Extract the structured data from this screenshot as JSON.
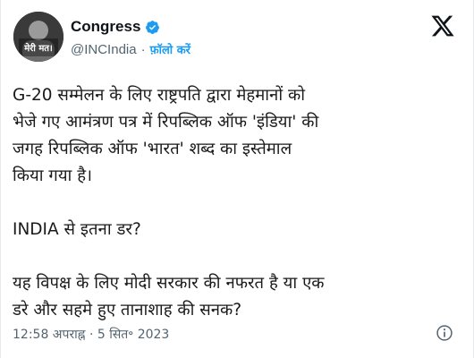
{
  "account": {
    "display_name": "Congress",
    "handle": "@INCIndia",
    "separator": "·",
    "follow_label": "फ़ॉलो करें",
    "avatar_text": "मेरी मत।"
  },
  "tweet": {
    "paragraph_1": [
      "G-20 सम्मेलन के लिए राष्ट्रपति द्वारा मेहमानों को",
      "भेजे गए आमंत्रण पत्र में रिपब्लिक ऑफ 'इंडिया' की",
      "जगह रिपब्लिक ऑफ 'भारत' शब्द का इस्तेमाल",
      "किया गया है।"
    ],
    "paragraph_2": "INDIA से इतना डर?",
    "paragraph_3": [
      "यह विपक्ष के लिए मोदी सरकार की नफरत है या एक",
      "डरे और सहमे हुए तानाशाह की सनक?"
    ],
    "timestamp": "12:58 अपराह्न · 5 सित॰ 2023"
  },
  "icons": {
    "verified": "verified-badge-icon",
    "brand": "x-logo-icon",
    "info": "info-icon"
  },
  "colors": {
    "accent": "#1d9bf0",
    "text": "#0f1419",
    "muted": "#536471"
  }
}
